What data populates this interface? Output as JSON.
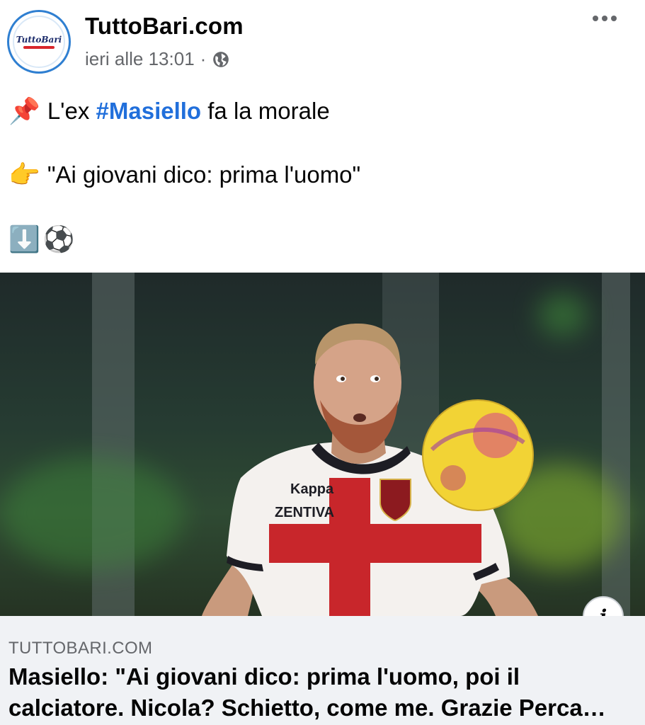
{
  "post": {
    "page_name": "TuttoBari.com",
    "timestamp": "ieri alle 13:01",
    "separator": "·",
    "audience_icon": "globe-icon",
    "more_icon": "more-options-icon",
    "avatar_text": "TuttoBari"
  },
  "body": {
    "line1": {
      "emoji": "📌",
      "prefix": "L'ex ",
      "hashtag": "#Masiello",
      "suffix": " fa la morale"
    },
    "line2": {
      "emoji": "👉",
      "text": "\"Ai giovani dico: prima l'uomo\""
    },
    "line3": {
      "emoji1": "⬇️",
      "emoji2": "⚽"
    }
  },
  "link_preview": {
    "image_alt": "Footballer in red-cross white jersey heading a yellow ball",
    "jersey_brand": "Kappa",
    "jersey_sponsor": "ZENTIVA",
    "domain": "TUTTOBARI.COM",
    "headline": "Masiello: \"Ai giovani dico: prima l'uomo, poi il calciatore. Nicola? Schietto, come me. Grazie Perca…",
    "info_icon": "info-icon",
    "info_label": "i"
  },
  "colors": {
    "hashtag": "#216fdb",
    "secondary_text": "#65676b",
    "preview_bg": "#f0f2f5",
    "jersey_red": "#c8262b"
  }
}
